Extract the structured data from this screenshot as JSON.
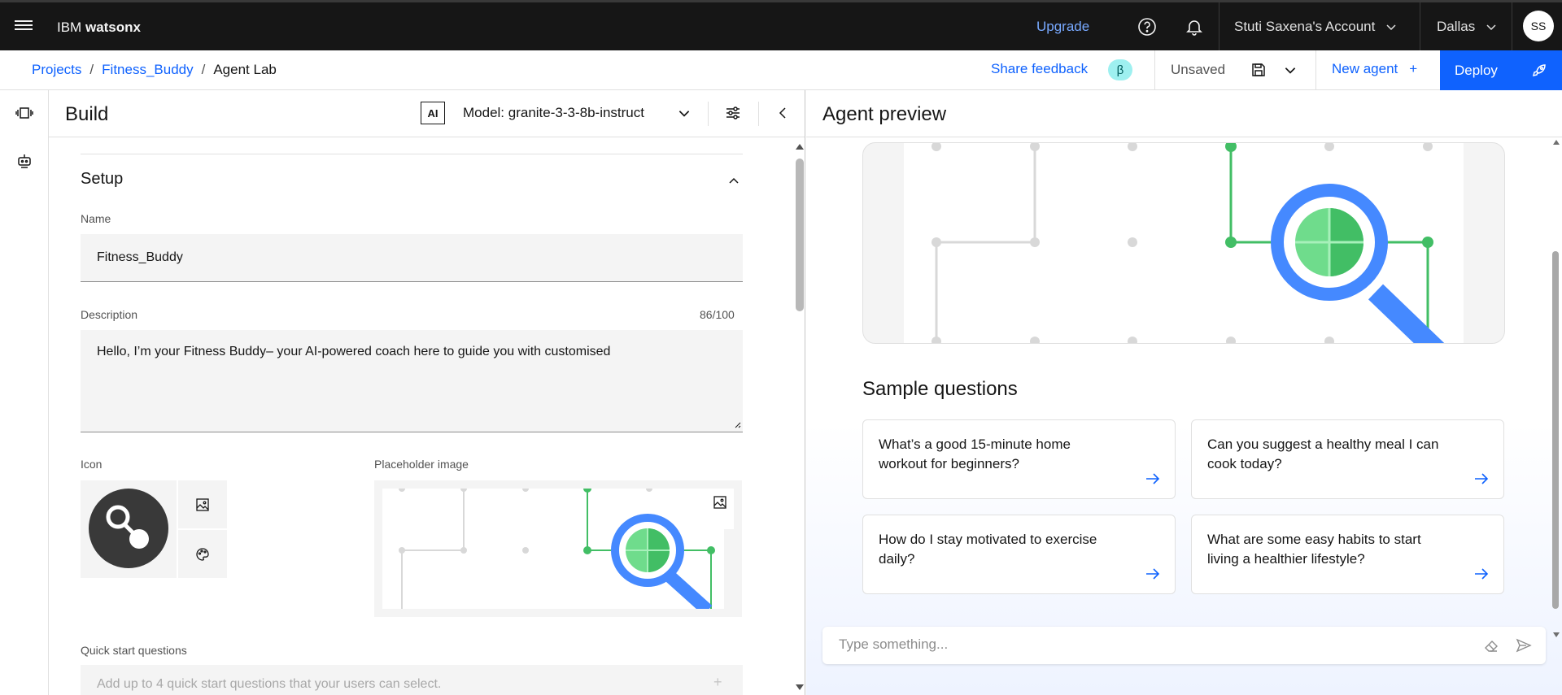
{
  "header": {
    "brand_prefix": "IBM",
    "brand_product": "watsonx",
    "upgrade": "Upgrade",
    "account": "Stuti Saxena's Account",
    "region": "Dallas",
    "avatar_initials": "SS"
  },
  "breadcrumb": {
    "items": [
      "Projects",
      "Fitness_Buddy",
      "Agent Lab"
    ],
    "separator": "/"
  },
  "toolbar": {
    "share_feedback": "Share feedback",
    "beta_badge": "β",
    "save_status": "Unsaved",
    "new_agent": "New agent",
    "new_agent_plus": "+",
    "deploy": "Deploy"
  },
  "build": {
    "title": "Build",
    "ai_badge": "AI",
    "model_label": "Model: granite-3-3-8b-instruct",
    "section_title": "Setup",
    "name_label": "Name",
    "name_value": "Fitness_Buddy",
    "description_label": "Description",
    "description_counter": "86/100",
    "description_value": "Hello, I’m your Fitness Buddy– your AI-powered coach here to guide you with customised",
    "icon_label": "Icon",
    "placeholder_image_label": "Placeholder image",
    "quick_start_label": "Quick start questions",
    "quick_start_placeholder": "Add up to 4 quick start questions that your users can select.",
    "quick_start_add": "+"
  },
  "preview": {
    "title": "Agent preview",
    "sample_questions_title": "Sample questions",
    "questions": [
      "What’s a good 15-minute home workout for beginners?",
      "Can you suggest a healthy meal I can cook today?",
      "How do I stay motivated to exercise daily?",
      "What are some easy habits to start living a healthier lifestyle?"
    ],
    "chat_placeholder": "Type something..."
  },
  "colors": {
    "primary": "#0f62fe",
    "header_bg": "#161616",
    "accent_green": "#42be65",
    "accent_blue": "#4589ff"
  },
  "icons": [
    "hamburger-icon",
    "help-icon",
    "notification-icon",
    "chevron-down-icon",
    "save-icon",
    "send-icon",
    "tune-icon",
    "chevron-left-icon",
    "chevron-up-icon",
    "image-icon",
    "palette-icon",
    "arrow-right-icon",
    "eraser-icon"
  ]
}
